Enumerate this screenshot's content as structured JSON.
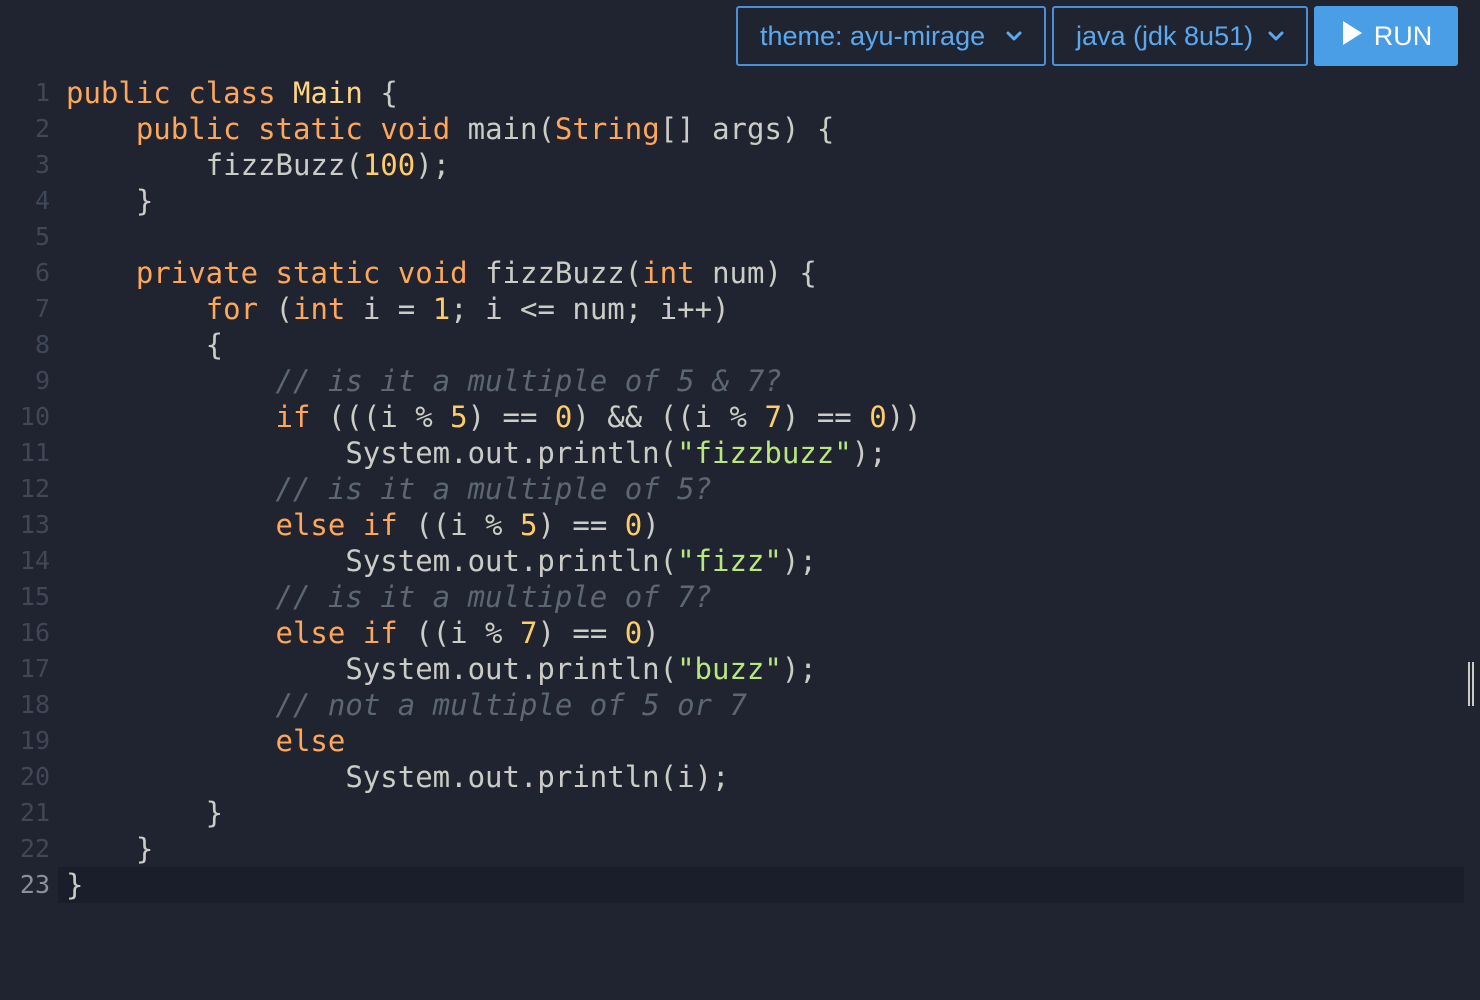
{
  "toolbar": {
    "theme_label": "theme: ayu-mirage",
    "language_label": "java (jdk 8u51)",
    "run_label": "RUN"
  },
  "editor": {
    "active_line": 23,
    "lines": [
      {
        "n": "1",
        "tokens": [
          [
            "kw",
            "public"
          ],
          [
            "p",
            " "
          ],
          [
            "kw",
            "class"
          ],
          [
            "p",
            " "
          ],
          [
            "cls",
            "Main"
          ],
          [
            "p",
            " {"
          ]
        ]
      },
      {
        "n": "2",
        "tokens": [
          [
            "p",
            "    "
          ],
          [
            "kw",
            "public"
          ],
          [
            "p",
            " "
          ],
          [
            "kw",
            "static"
          ],
          [
            "p",
            " "
          ],
          [
            "kw",
            "void"
          ],
          [
            "p",
            " main("
          ],
          [
            "ty",
            "String"
          ],
          [
            "p",
            "[] args) {"
          ]
        ]
      },
      {
        "n": "3",
        "tokens": [
          [
            "p",
            "        fizzBuzz("
          ],
          [
            "num",
            "100"
          ],
          [
            "p",
            ");"
          ]
        ]
      },
      {
        "n": "4",
        "tokens": [
          [
            "p",
            "    }"
          ]
        ]
      },
      {
        "n": "5",
        "tokens": []
      },
      {
        "n": "6",
        "tokens": [
          [
            "p",
            "    "
          ],
          [
            "kw",
            "private"
          ],
          [
            "p",
            " "
          ],
          [
            "kw",
            "static"
          ],
          [
            "p",
            " "
          ],
          [
            "kw",
            "void"
          ],
          [
            "p",
            " fizzBuzz("
          ],
          [
            "kw",
            "int"
          ],
          [
            "p",
            " num) {"
          ]
        ]
      },
      {
        "n": "7",
        "tokens": [
          [
            "p",
            "        "
          ],
          [
            "kw",
            "for"
          ],
          [
            "p",
            " ("
          ],
          [
            "kw",
            "int"
          ],
          [
            "p",
            " i = "
          ],
          [
            "num",
            "1"
          ],
          [
            "p",
            "; i <= num; i++)"
          ]
        ]
      },
      {
        "n": "8",
        "tokens": [
          [
            "p",
            "        {"
          ]
        ]
      },
      {
        "n": "9",
        "tokens": [
          [
            "p",
            "            "
          ],
          [
            "cm",
            "// is it a multiple of 5 & 7?"
          ]
        ]
      },
      {
        "n": "10",
        "tokens": [
          [
            "p",
            "            "
          ],
          [
            "kw",
            "if"
          ],
          [
            "p",
            " (((i % "
          ],
          [
            "num",
            "5"
          ],
          [
            "p",
            ") == "
          ],
          [
            "num",
            "0"
          ],
          [
            "p",
            ") && ((i % "
          ],
          [
            "num",
            "7"
          ],
          [
            "p",
            ") == "
          ],
          [
            "num",
            "0"
          ],
          [
            "p",
            "))"
          ]
        ]
      },
      {
        "n": "11",
        "tokens": [
          [
            "p",
            "                System.out.println("
          ],
          [
            "str",
            "\"fizzbuzz\""
          ],
          [
            "p",
            ");"
          ]
        ]
      },
      {
        "n": "12",
        "tokens": [
          [
            "p",
            "            "
          ],
          [
            "cm",
            "// is it a multiple of 5?"
          ]
        ]
      },
      {
        "n": "13",
        "tokens": [
          [
            "p",
            "            "
          ],
          [
            "kw",
            "else"
          ],
          [
            "p",
            " "
          ],
          [
            "kw",
            "if"
          ],
          [
            "p",
            " ((i % "
          ],
          [
            "num",
            "5"
          ],
          [
            "p",
            ") == "
          ],
          [
            "num",
            "0"
          ],
          [
            "p",
            ")"
          ]
        ]
      },
      {
        "n": "14",
        "tokens": [
          [
            "p",
            "                System.out.println("
          ],
          [
            "str",
            "\"fizz\""
          ],
          [
            "p",
            ");"
          ]
        ]
      },
      {
        "n": "15",
        "tokens": [
          [
            "p",
            "            "
          ],
          [
            "cm",
            "// is it a multiple of 7?"
          ]
        ]
      },
      {
        "n": "16",
        "tokens": [
          [
            "p",
            "            "
          ],
          [
            "kw",
            "else"
          ],
          [
            "p",
            " "
          ],
          [
            "kw",
            "if"
          ],
          [
            "p",
            " ((i % "
          ],
          [
            "num",
            "7"
          ],
          [
            "p",
            ") == "
          ],
          [
            "num",
            "0"
          ],
          [
            "p",
            ")"
          ]
        ]
      },
      {
        "n": "17",
        "tokens": [
          [
            "p",
            "                System.out.println("
          ],
          [
            "str",
            "\"buzz\""
          ],
          [
            "p",
            ");"
          ]
        ]
      },
      {
        "n": "18",
        "tokens": [
          [
            "p",
            "            "
          ],
          [
            "cm",
            "// not a multiple of 5 or 7"
          ]
        ]
      },
      {
        "n": "19",
        "tokens": [
          [
            "p",
            "            "
          ],
          [
            "kw",
            "else"
          ]
        ]
      },
      {
        "n": "20",
        "tokens": [
          [
            "p",
            "                System.out.println(i);"
          ]
        ]
      },
      {
        "n": "21",
        "tokens": [
          [
            "p",
            "        }"
          ]
        ]
      },
      {
        "n": "22",
        "tokens": [
          [
            "p",
            "    }"
          ]
        ]
      },
      {
        "n": "23",
        "tokens": [
          [
            "p",
            "}"
          ]
        ]
      }
    ]
  },
  "colors": {
    "background": "#1f2430",
    "accent": "#4a9ee6",
    "keyword": "#ffa759",
    "number": "#ffcc66",
    "string": "#bae67e",
    "comment": "#5c6773",
    "text": "#cbccc6"
  },
  "icons": {
    "theme_chevron": "chevron-down-icon",
    "language_chevron": "chevron-down-icon",
    "run": "play-icon"
  }
}
